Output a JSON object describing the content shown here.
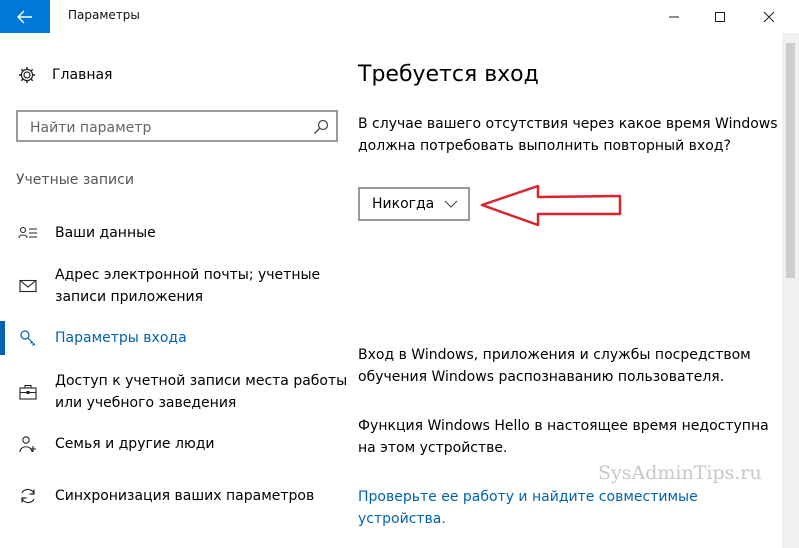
{
  "window": {
    "title": "Параметры",
    "icons": {
      "back": "arrow-left-icon",
      "minimize": "minimize-icon",
      "maximize": "maximize-icon",
      "close": "close-icon"
    }
  },
  "sidebar": {
    "home": {
      "label": "Главная",
      "icon": "gear-icon"
    },
    "search": {
      "placeholder": "Найти параметр",
      "icon": "search-icon"
    },
    "section_title": "Учетные записи",
    "items": [
      {
        "label": "Ваши данные",
        "icon": "person-card-icon",
        "active": false
      },
      {
        "label": "Адрес электронной почты; учетные записи приложения",
        "icon": "mail-icon",
        "active": false
      },
      {
        "label": "Параметры входа",
        "icon": "key-icon",
        "active": true
      },
      {
        "label": "Доступ к учетной записи места работы или учебного заведения",
        "icon": "briefcase-icon",
        "active": false
      },
      {
        "label": "Семья и другие люди",
        "icon": "person-add-icon",
        "active": false
      },
      {
        "label": "Синхронизация ваших параметров",
        "icon": "sync-icon",
        "active": false
      }
    ]
  },
  "content": {
    "title": "Требуется вход",
    "question": "В случае вашего отсутствия через какое время Windows должна потребовать выполнить повторный вход?",
    "dropdown": {
      "value": "Никогда"
    },
    "hello_intro": "Вход в Windows, приложения и службы посредством обучения Windows распознаванию пользователя.",
    "hello_status": "Функция Windows Hello в настоящее время недоступна на этом устройстве.",
    "link": "Проверьте ее работу и найдите совместимые устройства."
  },
  "watermark": "SysAdminTips.ru",
  "colors": {
    "accent": "#0063b1",
    "annotation": "#d9262c"
  }
}
